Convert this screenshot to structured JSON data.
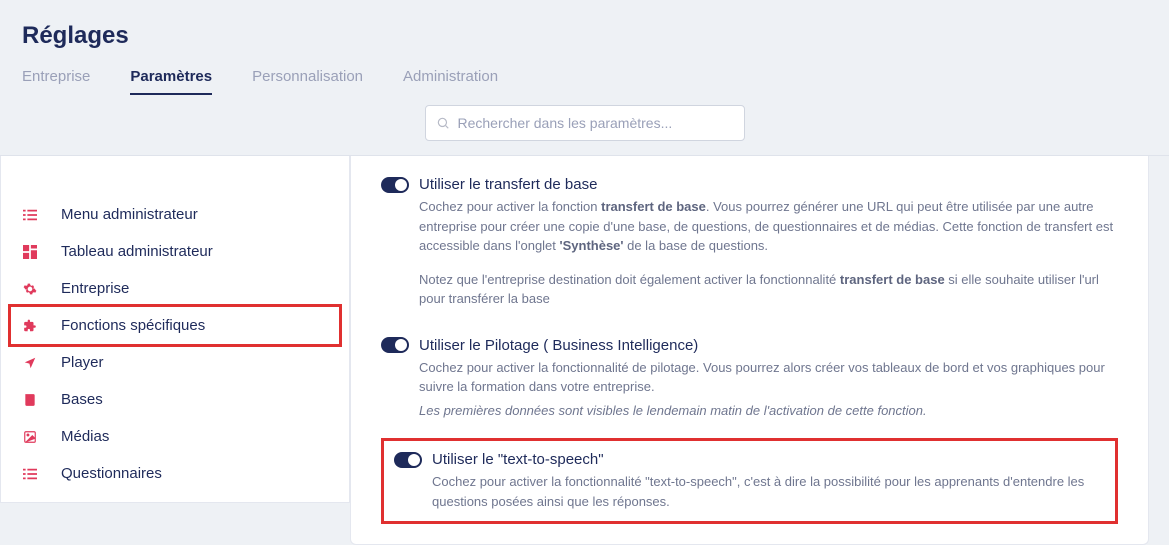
{
  "pageTitle": "Réglages",
  "tabs": {
    "entreprise": "Entreprise",
    "parametres": "Paramètres",
    "personnalisation": "Personnalisation",
    "administration": "Administration"
  },
  "search": {
    "placeholder": "Rechercher dans les paramètres..."
  },
  "sidebar": {
    "menuAdmin": "Menu administrateur",
    "tableauAdmin": "Tableau administrateur",
    "entreprise": "Entreprise",
    "fonctions": "Fonctions spécifiques",
    "player": "Player",
    "bases": "Bases",
    "medias": "Médias",
    "questionnaires": "Questionnaires"
  },
  "settings": {
    "transfert": {
      "title": "Utiliser le transfert de base",
      "desc1a": "Cochez pour activer la fonction ",
      "desc1b": "transfert de base",
      "desc1c": ". Vous pourrez générer une URL qui peut être utilisée par une autre entreprise pour créer une copie d'une base, de questions, de questionnaires et de médias. Cette fonction de transfert est accessible dans l'onglet ",
      "desc1d": "'Synthèse'",
      "desc1e": " de la base de questions.",
      "desc2a": "Notez que l'entreprise destination doit également activer la fonctionnalité ",
      "desc2b": "transfert de base",
      "desc2c": " si elle souhaite utiliser l'url pour transférer la base"
    },
    "pilotage": {
      "title": "Utiliser le Pilotage ( Business Intelligence)",
      "desc1": "Cochez pour activer la fonctionnalité de pilotage. Vous pourrez alors créer vos tableaux de bord et vos graphiques pour suivre la formation dans votre entreprise.",
      "desc2": "Les premières données sont visibles le lendemain matin de l'activation de cette fonction."
    },
    "tts": {
      "title": "Utiliser le \"text-to-speech\"",
      "desc": "Cochez pour activer la fonctionnalité \"text-to-speech\", c'est à dire la possibilité pour les apprenants d'entendre les questions posées ainsi que les réponses."
    }
  }
}
